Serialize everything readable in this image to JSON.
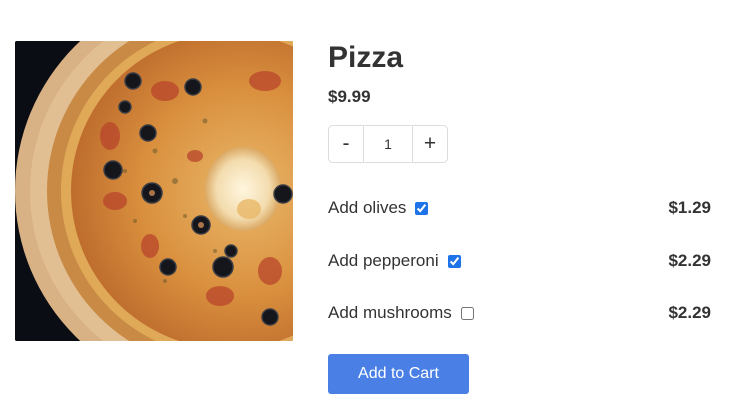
{
  "product": {
    "title": "Pizza",
    "price": "$9.99",
    "image_alt": "pizza-photo"
  },
  "quantity": {
    "decrement_label": "-",
    "value": "1",
    "increment_label": "+"
  },
  "addons": [
    {
      "label": "Add olives",
      "checked": true,
      "price": "$1.29"
    },
    {
      "label": "Add pepperoni",
      "checked": true,
      "price": "$2.29"
    },
    {
      "label": "Add mushrooms",
      "checked": false,
      "price": "$2.29"
    }
  ],
  "actions": {
    "add_to_cart_label": "Add to Cart"
  },
  "colors": {
    "accent": "#4a80e6",
    "text": "#333333"
  }
}
